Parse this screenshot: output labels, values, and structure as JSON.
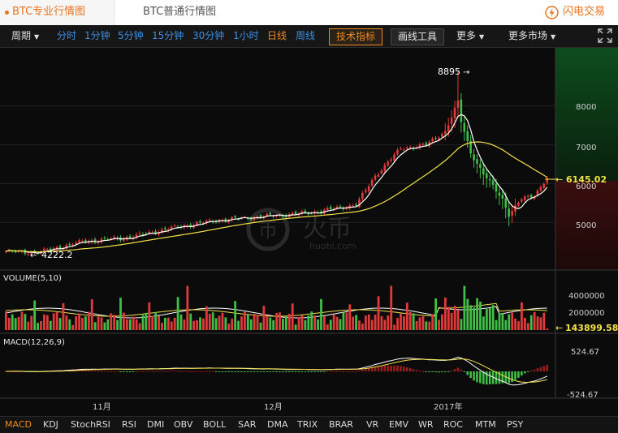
{
  "tabs": [
    {
      "label": "BTC专业行情图",
      "active": true
    },
    {
      "label": "BTC普通行情图",
      "active": false
    }
  ],
  "brand": {
    "name": "闪电交易",
    "icon": "lightning-icon",
    "color": "#e8741e"
  },
  "toolbar": {
    "cycle_label": "周期",
    "periods": [
      "分时",
      "1分钟",
      "5分钟",
      "15分钟",
      "30分钟",
      "1小时",
      "日线",
      "周线"
    ],
    "active_period": "日线",
    "tech_button": "技术指标",
    "draw_button": "画线工具",
    "more_label": "更多",
    "more_market_label": "更多市场",
    "fullscreen_icon": "fullscreen-icon"
  },
  "watermark": {
    "text": "火币",
    "sub": "huobi.com"
  },
  "colors": {
    "up": "#e03a3a",
    "down": "#3fbf46",
    "ma_fast": "#ffffff",
    "ma_slow": "#f2e14a",
    "accent": "#f08a1f"
  },
  "price_panel": {
    "y_ticks": [
      "8000",
      "7000",
      "6000",
      "5000"
    ],
    "current_price": "6145.02",
    "high_label": "8895",
    "low_label": "4222.2"
  },
  "volume_panel": {
    "title": "VOLUME(5,10)",
    "y_ticks": [
      "4000000",
      "2000000"
    ],
    "current_value": "143899.58"
  },
  "macd_panel": {
    "title": "MACD(12,26,9)",
    "y_ticks": [
      "524.67",
      "-524.67"
    ]
  },
  "x_axis": [
    "11月",
    "12月",
    "2017年"
  ],
  "indicators": [
    "MACD",
    "KDJ",
    "StochRSI",
    "RSI",
    "DMI",
    "OBV",
    "BOLL",
    "SAR",
    "DMA",
    "TRIX",
    "BRAR",
    "VR",
    "EMV",
    "WR",
    "ROC",
    "MTM",
    "PSY"
  ],
  "active_indicator": "MACD",
  "chart_data": {
    "type": "candlestick",
    "price_range": [
      4000,
      8895
    ],
    "volume_range": [
      0,
      4500000
    ],
    "macd_range": [
      -524.67,
      524.67
    ],
    "anchors": [
      {
        "x": 0,
        "close": 4250
      },
      {
        "x": 10,
        "close": 4222.2
      },
      {
        "x": 24,
        "close": 4500
      },
      {
        "x": 38,
        "close": 4600
      },
      {
        "x": 52,
        "close": 4850
      },
      {
        "x": 66,
        "close": 5050
      },
      {
        "x": 80,
        "close": 5150
      },
      {
        "x": 96,
        "close": 5250
      },
      {
        "x": 110,
        "close": 5450
      },
      {
        "x": 116,
        "close": 6200
      },
      {
        "x": 124,
        "close": 6900
      },
      {
        "x": 132,
        "close": 7000
      },
      {
        "x": 138,
        "close": 7350
      },
      {
        "x": 142,
        "close": 8100
      },
      {
        "x": 143,
        "close": 7600
      },
      {
        "x": 146,
        "close": 6800
      },
      {
        "x": 150,
        "close": 6250
      },
      {
        "x": 156,
        "close": 5600
      },
      {
        "x": 158,
        "close": 5200
      },
      {
        "x": 162,
        "close": 5600
      },
      {
        "x": 166,
        "close": 5700
      },
      {
        "x": 170,
        "close": 6145.02
      }
    ]
  }
}
